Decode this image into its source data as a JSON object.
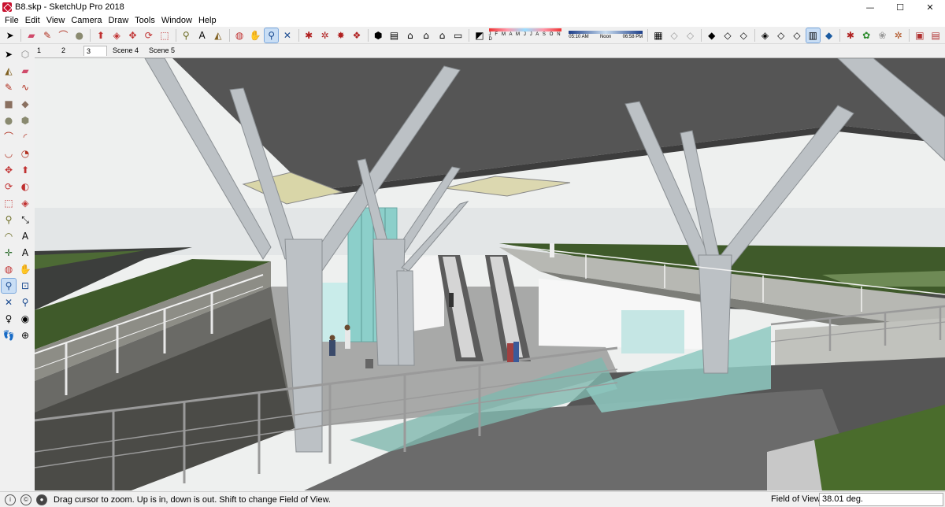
{
  "window": {
    "title": "B8.skp - SketchUp Pro 2018",
    "minimize": "—",
    "maximize": "☐",
    "close": "✕"
  },
  "menu": [
    "File",
    "Edit",
    "View",
    "Camera",
    "Draw",
    "Tools",
    "Window",
    "Help"
  ],
  "toolbar": {
    "shadow_months": "J F M A M J J A S O N D",
    "time_start": "05:10 AM",
    "time_mid": "Noon",
    "time_end": "06:58 PM"
  },
  "scene_tabs": [
    {
      "label": "1"
    },
    {
      "label": "2"
    },
    {
      "label": "3",
      "active": true
    },
    {
      "label": "Scene 4"
    },
    {
      "label": "Scene 5"
    }
  ],
  "status": {
    "message": "Drag cursor to zoom.  Up is in, down is out. Shift to change Field of View.",
    "vcb_label": "Field of View",
    "vcb_value": "38.01 deg."
  },
  "colors": {
    "sky": "#eceeed",
    "canopy": "#555555",
    "column": "#b9bec2",
    "grass": "#3f5a2a",
    "glass": "#9fd6d0"
  }
}
